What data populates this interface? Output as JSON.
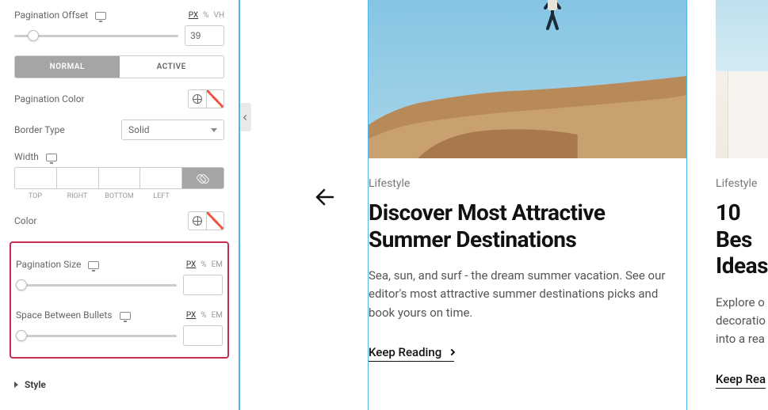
{
  "sidebar": {
    "pagination_offset": {
      "label": "Pagination Offset",
      "units": [
        "PX",
        "%",
        "VH"
      ],
      "active_unit": "PX",
      "value": "39",
      "thumb_pct": 8
    },
    "tabs": {
      "normal": "NORMAL",
      "active": "ACTIVE"
    },
    "pagination_color_label": "Pagination Color",
    "border_type": {
      "label": "Border Type",
      "value": "Solid"
    },
    "width": {
      "label": "Width",
      "labels": [
        "TOP",
        "RIGHT",
        "BOTTOM",
        "LEFT",
        ""
      ]
    },
    "color_label": "Color",
    "pagination_size": {
      "label": "Pagination Size",
      "units": [
        "PX",
        "%",
        "EM"
      ],
      "active_unit": "PX",
      "value": "",
      "thumb_pct": 0
    },
    "space_between": {
      "label": "Space Between Bullets",
      "units": [
        "PX",
        "%",
        "EM"
      ],
      "active_unit": "PX",
      "value": "",
      "thumb_pct": 0
    },
    "style_section": "Style"
  },
  "cards": [
    {
      "category": "Lifestyle",
      "title": "Discover Most Attractive Summer Destinations",
      "desc": "Sea, sun, and surf - the dream summer vacation. See our editor's most attractive summer destinations picks and book yours on time.",
      "cta": "Keep Reading"
    },
    {
      "category": "Lifestyle",
      "title": "10 Bes Ideas",
      "desc": "Explore o decoratio into a rea",
      "cta": "Keep Rea"
    }
  ]
}
